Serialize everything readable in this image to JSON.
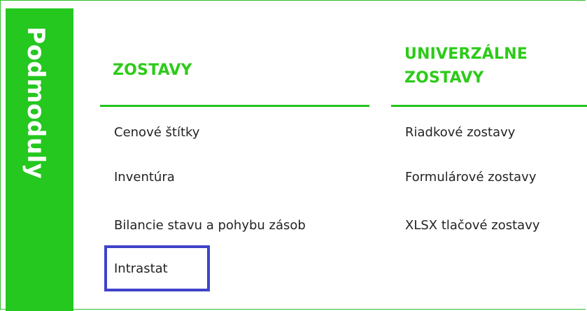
{
  "side_tab": {
    "label": "Podmoduly"
  },
  "columns": [
    {
      "header": "ZOSTAVY",
      "items": [
        "Cenové štítky",
        "Inventúra",
        "Bilancie stavu a pohybu zásob",
        "Intrastat"
      ]
    },
    {
      "header": "UNIVERZÁLNE ZOSTAVY",
      "items": [
        "Riadkové zostavy",
        "Formulárové zostavy",
        "XLSX tlačové zostavy"
      ]
    }
  ],
  "highlighted_item": "Intrastat",
  "colors": {
    "accent_green": "#24c81f",
    "highlight_blue": "#3f43c9"
  }
}
